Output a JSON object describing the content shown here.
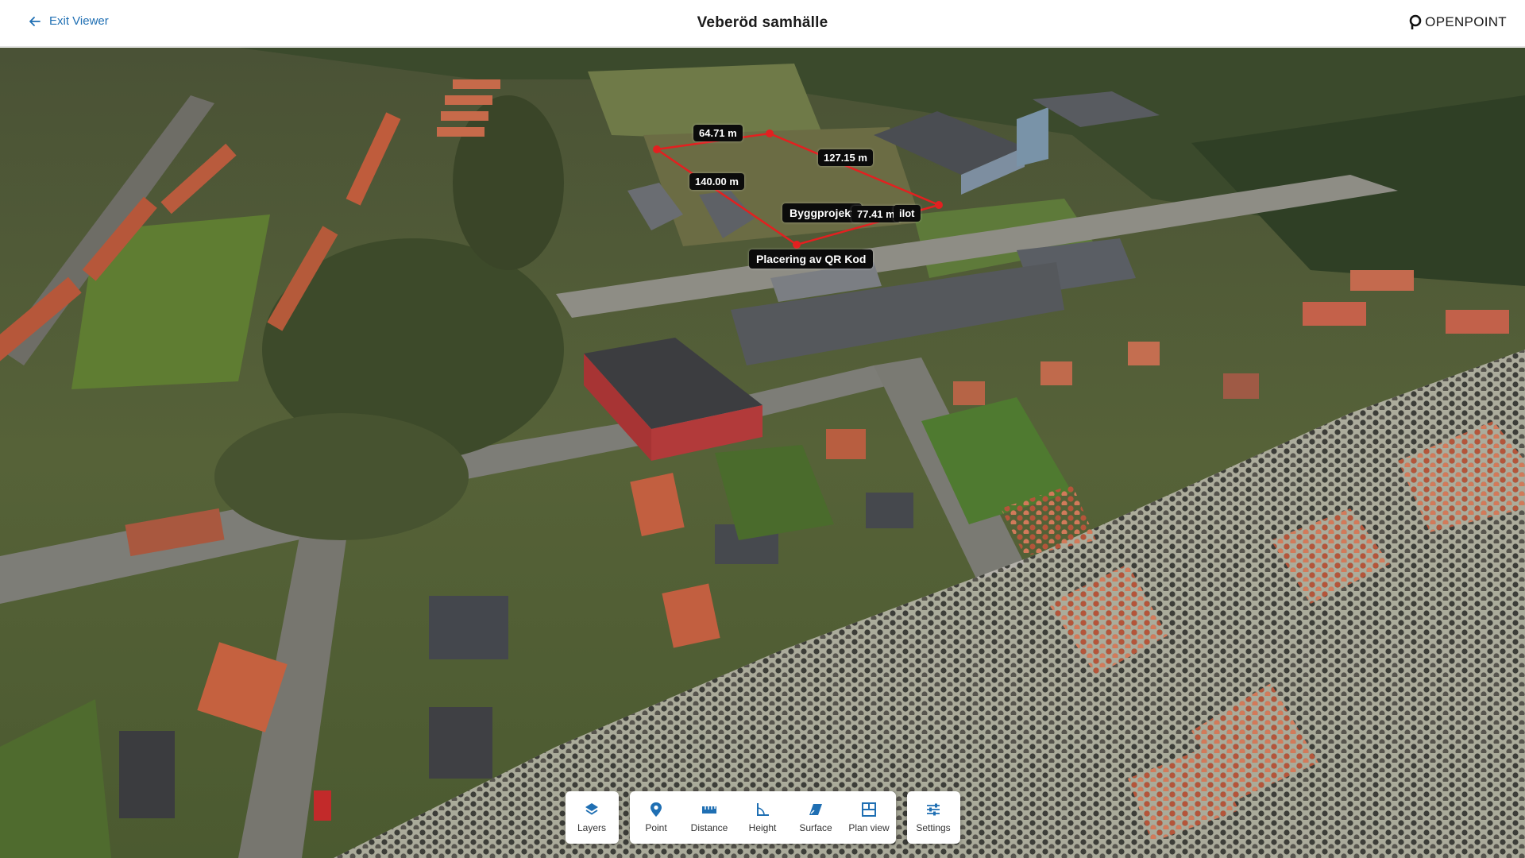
{
  "header": {
    "exit_label": "Exit Viewer",
    "title": "Veberöd samhälle",
    "brand": "OPENPOINT"
  },
  "measurements": [
    {
      "label": "64.71 m"
    },
    {
      "label": "127.15 m"
    },
    {
      "label": "140.00 m"
    },
    {
      "label": "Byggprojekt"
    },
    {
      "label": "77.41 m"
    },
    {
      "label": "ilot"
    },
    {
      "label": "Placering av QR Kod"
    }
  ],
  "toolbar": {
    "groups": [
      [
        {
          "label": "Layers",
          "icon": "layers-icon"
        }
      ],
      [
        {
          "label": "Point",
          "icon": "pin-icon"
        },
        {
          "label": "Distance",
          "icon": "ruler-icon"
        },
        {
          "label": "Height",
          "icon": "height-icon"
        },
        {
          "label": "Surface",
          "icon": "surface-icon"
        },
        {
          "label": "Plan view",
          "icon": "plan-view-icon"
        }
      ],
      [
        {
          "label": "Settings",
          "icon": "settings-icon"
        }
      ]
    ]
  },
  "colors": {
    "accent": "#1f6fb3",
    "measure_line": "#e32020",
    "icon_blue": "#1f6fb3"
  }
}
